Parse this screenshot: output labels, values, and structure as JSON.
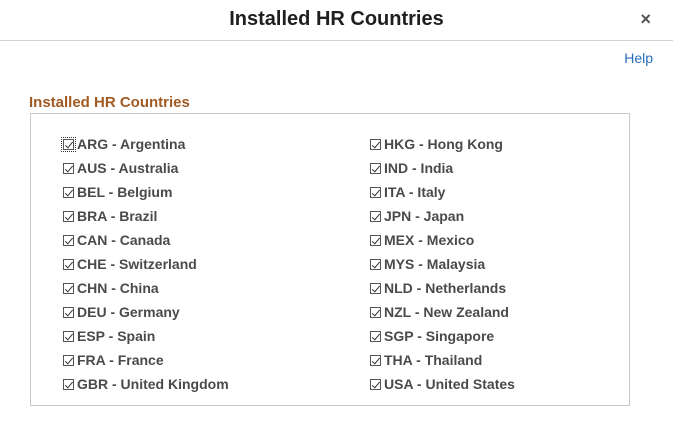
{
  "dialog": {
    "title": "Installed HR Countries",
    "close_icon": "×",
    "help_label": "Help"
  },
  "section": {
    "title": "Installed HR Countries"
  },
  "countries": {
    "left": [
      {
        "label": "ARG - Argentina",
        "checked": true
      },
      {
        "label": "AUS - Australia",
        "checked": true
      },
      {
        "label": "BEL - Belgium",
        "checked": true
      },
      {
        "label": "BRA - Brazil",
        "checked": true
      },
      {
        "label": "CAN - Canada",
        "checked": true
      },
      {
        "label": "CHE - Switzerland",
        "checked": true
      },
      {
        "label": "CHN - China",
        "checked": true
      },
      {
        "label": "DEU - Germany",
        "checked": true
      },
      {
        "label": "ESP - Spain",
        "checked": true
      },
      {
        "label": "FRA - France",
        "checked": true
      },
      {
        "label": "GBR - United Kingdom",
        "checked": true
      }
    ],
    "right": [
      {
        "label": "HKG - Hong Kong",
        "checked": true
      },
      {
        "label": "IND - India",
        "checked": true
      },
      {
        "label": "ITA - Italy",
        "checked": true
      },
      {
        "label": "JPN - Japan",
        "checked": true
      },
      {
        "label": "MEX - Mexico",
        "checked": true
      },
      {
        "label": "MYS - Malaysia",
        "checked": true
      },
      {
        "label": "NLD - Netherlands",
        "checked": true
      },
      {
        "label": "NZL - New Zealand",
        "checked": true
      },
      {
        "label": "SGP - Singapore",
        "checked": true
      },
      {
        "label": "THA - Thailand",
        "checked": true
      },
      {
        "label": "USA - United States",
        "checked": true
      }
    ]
  }
}
